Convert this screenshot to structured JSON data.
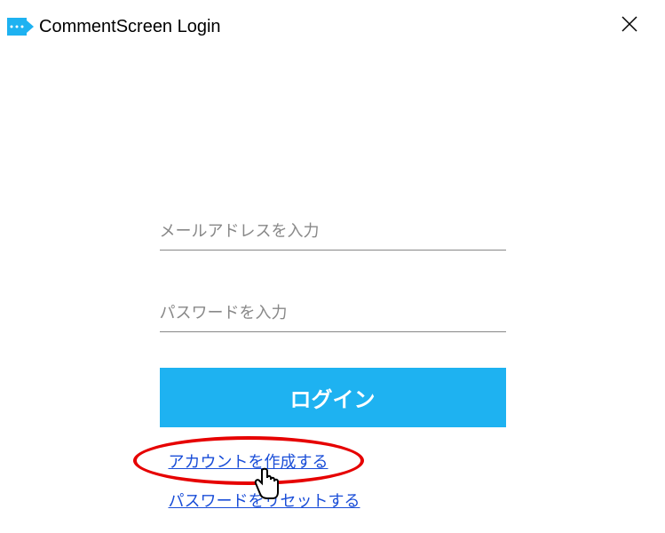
{
  "header": {
    "title": "CommentScreen Login"
  },
  "form": {
    "email_placeholder": "メールアドレスを入力",
    "password_placeholder": "パスワードを入力",
    "login_button_label": "ログイン"
  },
  "links": {
    "create_account": "アカウントを作成する",
    "reset_password": "パスワードをリセットする"
  }
}
